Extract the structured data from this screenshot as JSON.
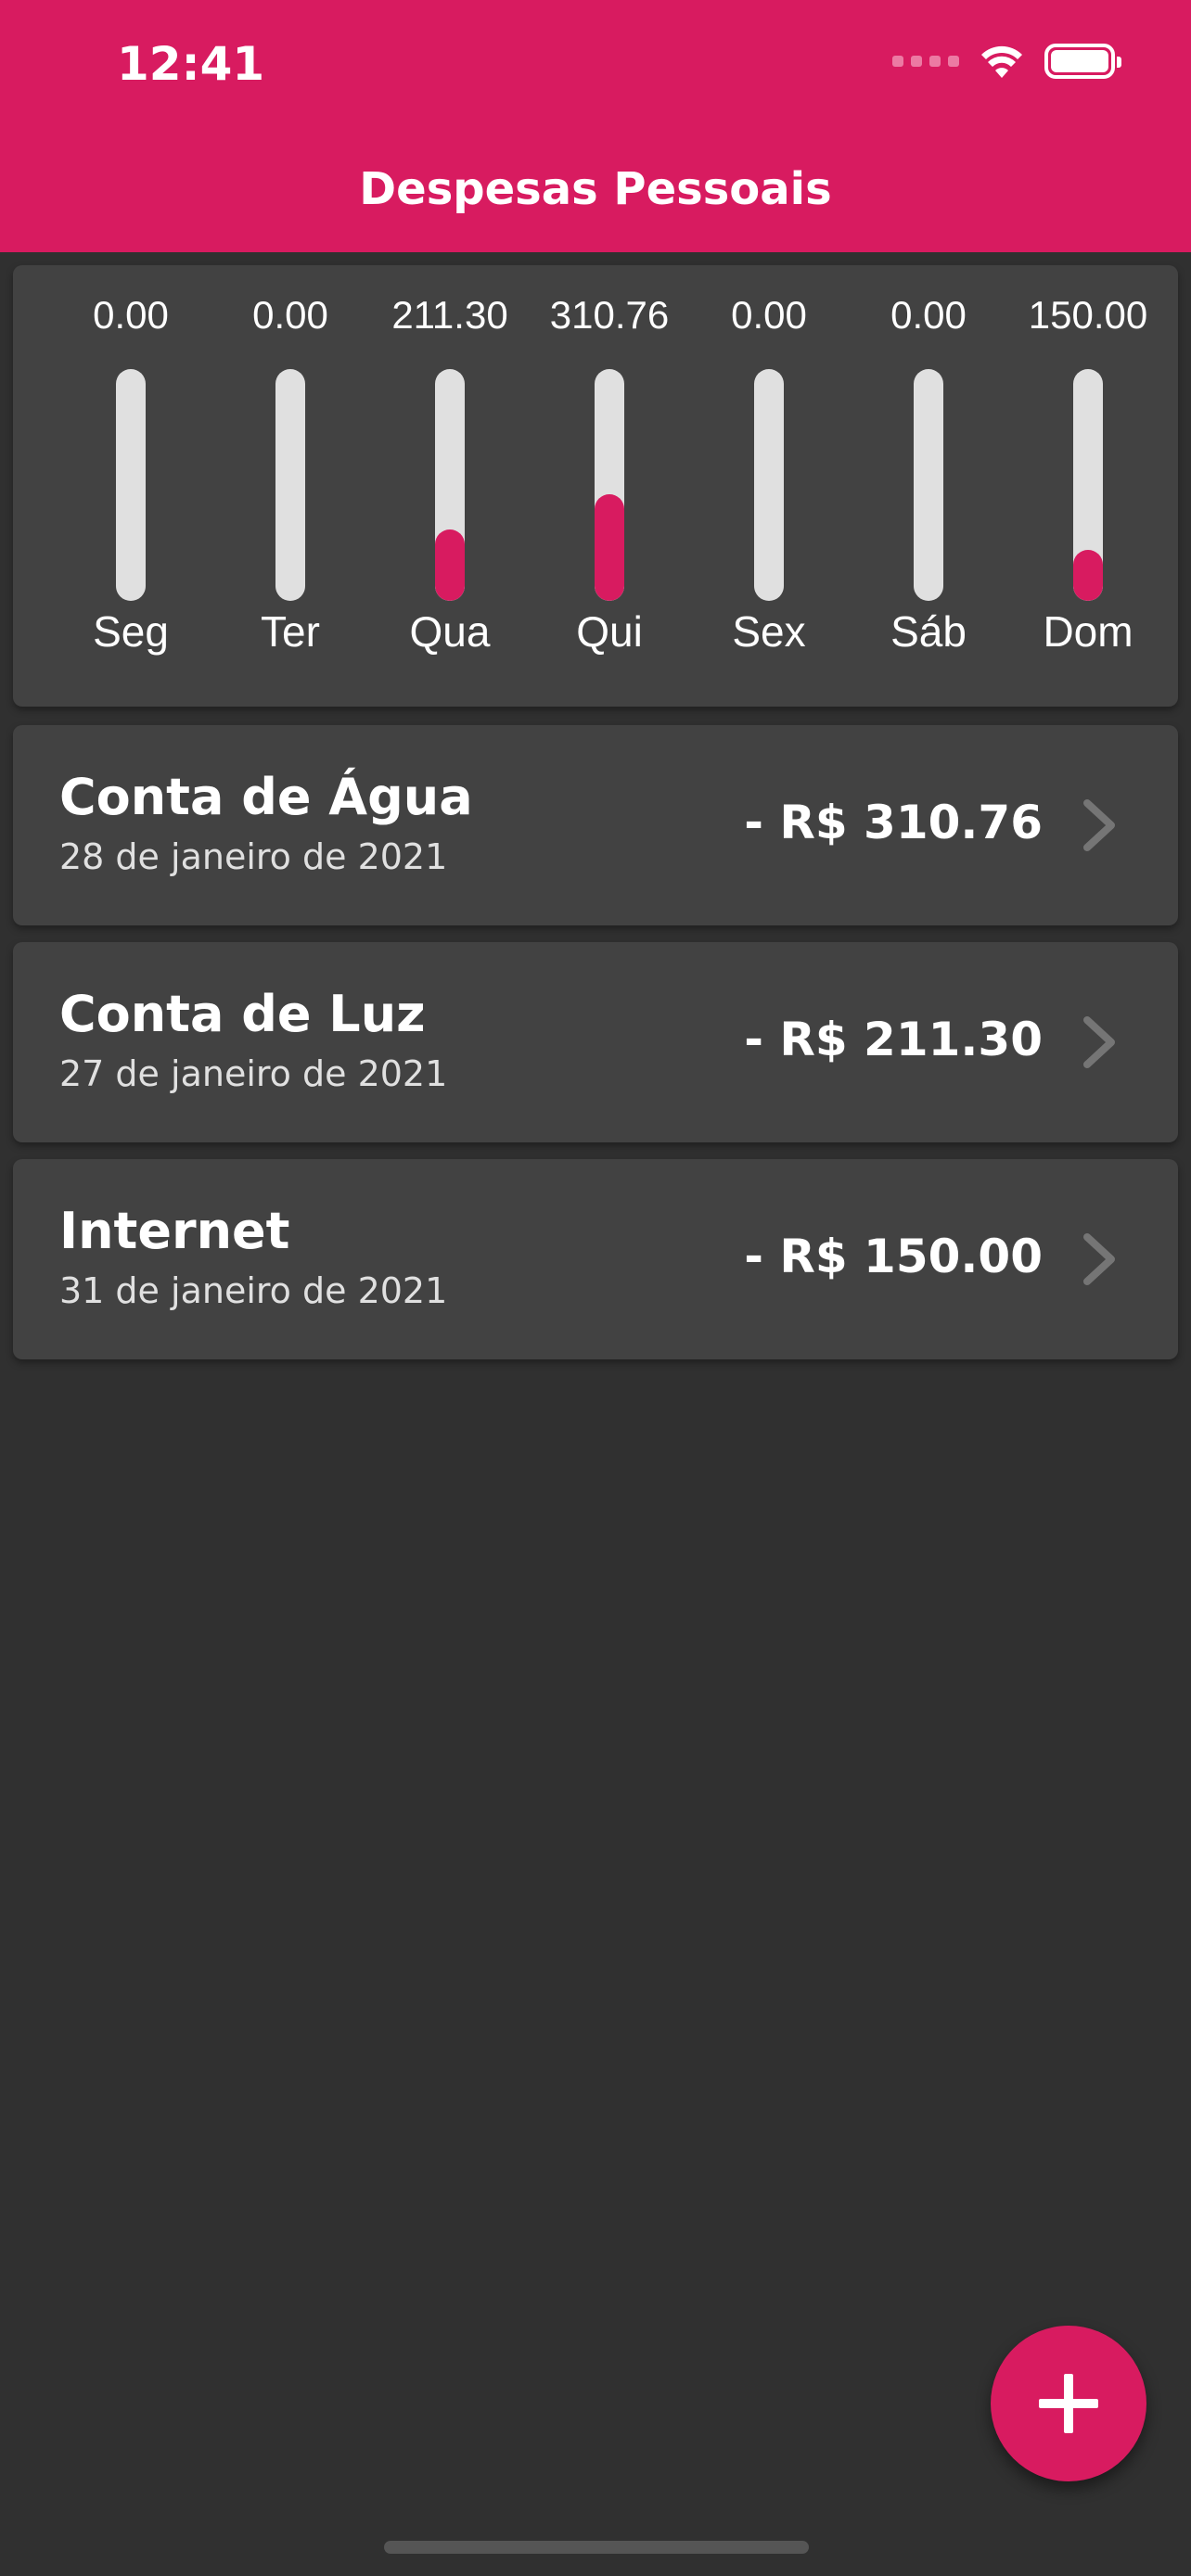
{
  "status_bar": {
    "time": "12:41"
  },
  "app_bar": {
    "title": "Despesas Pessoais"
  },
  "chart_data": {
    "type": "bar",
    "categories": [
      "Seg",
      "Ter",
      "Qua",
      "Qui",
      "Sex",
      "Sáb",
      "Dom"
    ],
    "values": [
      0.0,
      0.0,
      211.3,
      310.76,
      0.0,
      0.0,
      150.0
    ],
    "value_labels": [
      "0.00",
      "0.00",
      "211.30",
      "310.76",
      "0.00",
      "0.00",
      "150.00"
    ],
    "fill_fraction": [
      0.0,
      0.0,
      0.31,
      0.46,
      0.0,
      0.0,
      0.22
    ],
    "title": "",
    "xlabel": "",
    "ylabel": "",
    "grid": false
  },
  "transactions": [
    {
      "title": "Conta de Água",
      "date": "28 de janeiro de 2021",
      "amount": "- R$ 310.76"
    },
    {
      "title": "Conta de Luz",
      "date": "27 de janeiro de 2021",
      "amount": "- R$ 211.30"
    },
    {
      "title": "Internet",
      "date": "31 de janeiro de 2021",
      "amount": "- R$ 150.00"
    }
  ],
  "colors": {
    "primary": "#d81b60",
    "background": "#303030",
    "card": "#424242",
    "bar_track": "#e0e0e0"
  },
  "icons": {
    "wifi": "wifi-icon",
    "battery": "battery-icon",
    "chevron": "chevron-right-icon",
    "add": "plus-icon"
  }
}
